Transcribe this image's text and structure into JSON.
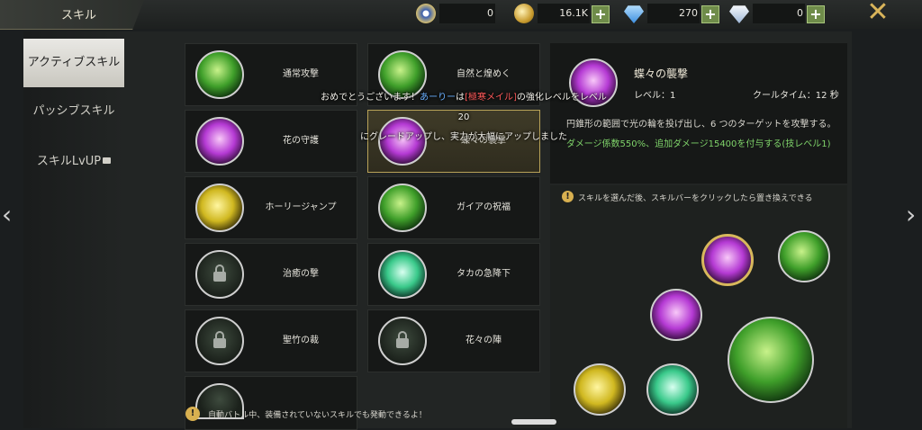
{
  "header": {
    "title": "スキル",
    "currencies": [
      {
        "icon": "sp-coin-icon",
        "value": "0",
        "has_plus": false
      },
      {
        "icon": "gold-coin-icon",
        "value": "16.1K",
        "has_plus": true
      },
      {
        "icon": "blue-diamond-icon",
        "value": "270",
        "has_plus": true
      },
      {
        "icon": "white-diamond-icon",
        "value": "0",
        "has_plus": true
      }
    ],
    "plus_label": "+",
    "close_label": "✕"
  },
  "nav": {
    "items": [
      {
        "label": "アクティブスキル",
        "active": true
      },
      {
        "label": "パッシブスキル",
        "active": false
      },
      {
        "label": "スキルLvUP",
        "active": false,
        "locked": true
      }
    ],
    "prev_arrow": "‹",
    "next_arrow": "›"
  },
  "skills": [
    {
      "name": "通常攻撃",
      "color": "green",
      "locked": false,
      "selected": false
    },
    {
      "name": "自然と煌めく",
      "color": "green",
      "locked": false,
      "selected": false
    },
    {
      "name": "花の守護",
      "color": "pink",
      "locked": false,
      "selected": false
    },
    {
      "name": "蝶々の襲撃",
      "color": "pink",
      "locked": false,
      "selected": true
    },
    {
      "name": "ホーリージャンプ",
      "color": "yellow",
      "locked": false,
      "selected": false
    },
    {
      "name": "ガイアの祝福",
      "color": "green",
      "locked": false,
      "selected": false
    },
    {
      "name": "治癒の撃",
      "color": "locked",
      "locked": true,
      "selected": false
    },
    {
      "name": "タカの急降下",
      "color": "teal",
      "locked": false,
      "selected": false
    },
    {
      "name": "聖竹の裁",
      "color": "locked",
      "locked": true,
      "selected": false
    },
    {
      "name": "花々の陣",
      "color": "locked",
      "locked": true,
      "selected": false
    }
  ],
  "detail": {
    "name": "蝶々の襲撃",
    "level": "レベル：1",
    "cooldown": "クールタイム：12 秒",
    "description": "円錐形の範囲で光の輪を投げ出し、6 つのターゲットを攻撃する。",
    "damage": "ダメージ係数550%、追加ダメージ15400を付与する(技レベル1)"
  },
  "loadout": {
    "hint": "スキルを選んだ後、スキルバーをクリックしたら置き換えできる"
  },
  "notice": {
    "part1": "おめでとうございます！",
    "player": "あーりー",
    "part2": "は",
    "item": "[極寒メイル]",
    "part3": "の強化レベルをレベル20",
    "line2": "にグレードアップし、実力が大幅にアップしました"
  },
  "footer": {
    "tip": "自動バトル中、装備されていないスキルでも発動できるよ！"
  },
  "colors": {
    "gold": "#d8b85c",
    "damage_text": "#7fd36a",
    "plus_button": "#6f8c4a"
  }
}
